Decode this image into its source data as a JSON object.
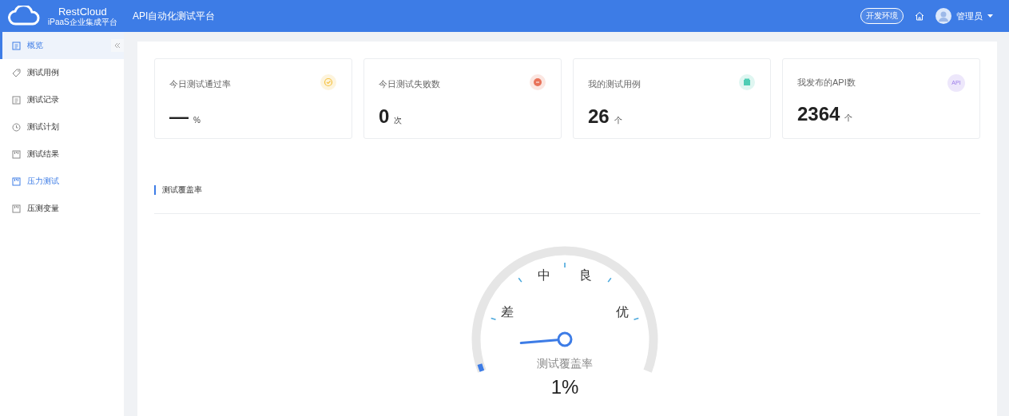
{
  "header": {
    "brand": "RestCloud",
    "brand_sub": "iPaaS企业集成平台",
    "title": "API自动化测试平台",
    "env": "开发环境",
    "user": "管理员"
  },
  "sidebar": {
    "items": [
      {
        "label": "概览",
        "kind": "doc",
        "selected": true,
        "highlighted": false
      },
      {
        "label": "测试用例",
        "kind": "tag",
        "selected": false,
        "highlighted": false
      },
      {
        "label": "测试记录",
        "kind": "doc",
        "selected": false,
        "highlighted": false
      },
      {
        "label": "测试计划",
        "kind": "clock",
        "selected": false,
        "highlighted": false
      },
      {
        "label": "测试结果",
        "kind": "board",
        "selected": false,
        "highlighted": false
      },
      {
        "label": "压力测试",
        "kind": "board",
        "selected": false,
        "highlighted": true
      },
      {
        "label": "压测变量",
        "kind": "board",
        "selected": false,
        "highlighted": false
      }
    ]
  },
  "stats": [
    {
      "title": "今日测试通过率",
      "value": "—",
      "unit": "%",
      "kind": "check"
    },
    {
      "title": "今日测试失败数",
      "value": "0",
      "unit": "次",
      "kind": "error"
    },
    {
      "title": "我的测试用例",
      "value": "26",
      "unit": "个",
      "kind": "box"
    },
    {
      "title": "我发布的API数",
      "value": "2364",
      "unit": "个",
      "kind": "badge",
      "badge": "API"
    }
  ],
  "coverage": {
    "title": "测试覆盖率",
    "gauge": {
      "labels": [
        "差",
        "中",
        "良",
        "优"
      ],
      "caption": "测试覆盖率",
      "reading": "1%",
      "level": 0.01
    }
  }
}
